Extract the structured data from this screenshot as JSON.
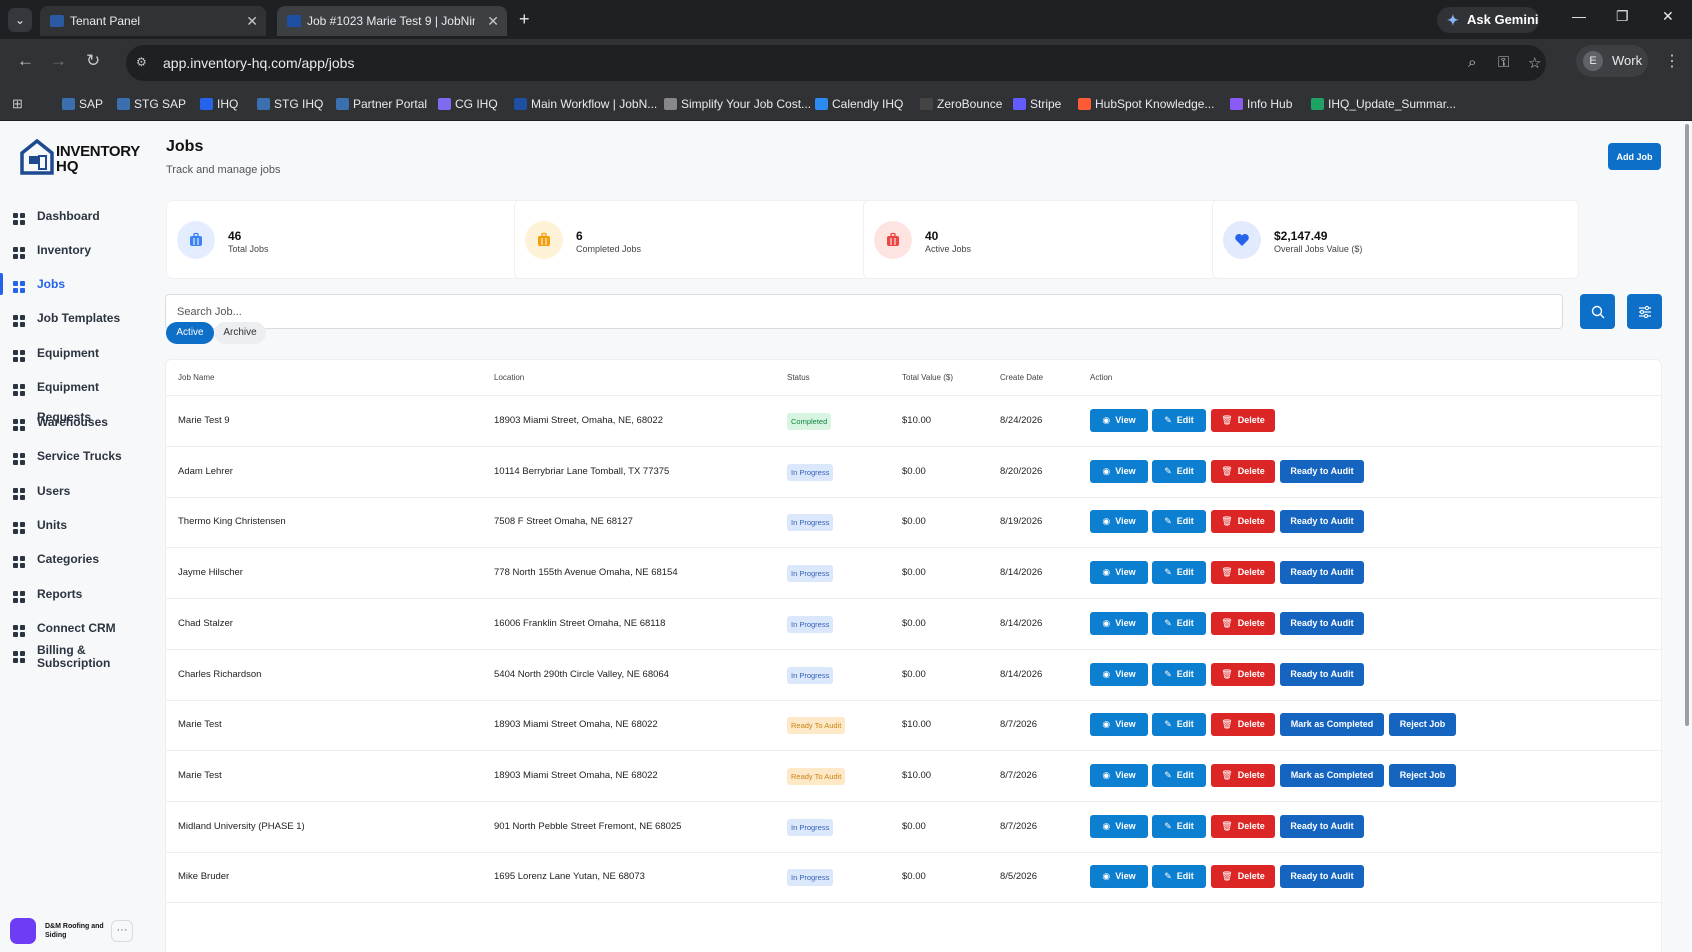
{
  "browser": {
    "tabs": [
      {
        "title": "Tenant Panel",
        "active": false
      },
      {
        "title": "Job #1023 Marie Test 9 | JobNimbus",
        "active": true
      }
    ],
    "ask_gemini": "Ask Gemini",
    "url": "app.inventory-hq.com/app/jobs",
    "profile": {
      "initial": "E",
      "name": "Work"
    },
    "bookmarks": [
      "SAP",
      "STG SAP",
      "IHQ",
      "STG IHQ",
      "Partner Portal",
      "CG IHQ",
      "Main Workflow | JobN...",
      "Simplify Your Job Cost...",
      "Calendly IHQ",
      "ZeroBounce",
      "Stripe",
      "HubSpot Knowledge...",
      "Info Hub",
      "IHQ_Update_Summar..."
    ]
  },
  "logo": {
    "line1": "INVENTORY",
    "line2": "HQ"
  },
  "sidebar": {
    "items": [
      {
        "label": "Dashboard",
        "icon": "dashboard-icon"
      },
      {
        "label": "Inventory",
        "icon": "inventory-icon"
      },
      {
        "label": "Jobs",
        "icon": "jobs-icon",
        "active": true
      },
      {
        "label": "Job Templates",
        "icon": "job-templates-icon"
      },
      {
        "label": "Equipment",
        "icon": "equipment-icon"
      },
      {
        "label": "Equipment Requests",
        "icon": "equipment-requests-icon"
      },
      {
        "label": "Warehouses",
        "icon": "warehouse-icon"
      },
      {
        "label": "Service Trucks",
        "icon": "truck-icon"
      },
      {
        "label": "Users",
        "icon": "users-icon"
      },
      {
        "label": "Units",
        "icon": "units-icon"
      },
      {
        "label": "Categories",
        "icon": "categories-icon"
      },
      {
        "label": "Reports",
        "icon": "reports-icon"
      },
      {
        "label": "Connect CRM",
        "icon": "crm-icon"
      },
      {
        "label": "Billing & Subscription",
        "icon": "billing-icon"
      }
    ],
    "org_name": "D&M Roofing and Siding"
  },
  "header": {
    "title": "Jobs",
    "subtitle": "Track and manage jobs",
    "add_button": "Add Job"
  },
  "stats": [
    {
      "value": "46",
      "label": "Total Jobs",
      "color": "#3b82f6"
    },
    {
      "value": "6",
      "label": "Completed Jobs",
      "color": "#f59e0b"
    },
    {
      "value": "40",
      "label": "Active Jobs",
      "color": "#ef4444"
    },
    {
      "value": "$2,147.49",
      "label": "Overall Jobs Value ($)",
      "color": "#2563eb"
    }
  ],
  "search": {
    "placeholder": "Search Job..."
  },
  "filter_tabs": {
    "active": "Active",
    "archive": "Archive"
  },
  "table": {
    "columns": [
      "Job Name",
      "Location",
      "Status",
      "Total Value ($)",
      "Create Date",
      "Action"
    ],
    "actions": {
      "view": "View",
      "edit": "Edit",
      "delete": "Delete"
    },
    "rows": [
      {
        "name": "Marie Test 9",
        "location": "18903 Miami Street, Omaha, NE, 68022",
        "status": "Completed",
        "value": "$10.00",
        "date": "8/24/2026",
        "extra": []
      },
      {
        "name": "Adam Lehrer",
        "location": "10114 Berrybriar Lane Tomball, TX 77375",
        "status": "In Progress",
        "value": "$0.00",
        "date": "8/20/2026",
        "extra": [
          "Ready to Audit"
        ]
      },
      {
        "name": "Thermo King Christensen",
        "location": "7508 F Street Omaha, NE 68127",
        "status": "In Progress",
        "value": "$0.00",
        "date": "8/19/2026",
        "extra": [
          "Ready to Audit"
        ]
      },
      {
        "name": "Jayme Hilscher",
        "location": "778 North 155th Avenue Omaha, NE 68154",
        "status": "In Progress",
        "value": "$0.00",
        "date": "8/14/2026",
        "extra": [
          "Ready to Audit"
        ]
      },
      {
        "name": "Chad Stalzer",
        "location": "16006 Franklin Street Omaha, NE 68118",
        "status": "In Progress",
        "value": "$0.00",
        "date": "8/14/2026",
        "extra": [
          "Ready to Audit"
        ]
      },
      {
        "name": "Charles Richardson",
        "location": "5404 North 290th Circle Valley, NE 68064",
        "status": "In Progress",
        "value": "$0.00",
        "date": "8/14/2026",
        "extra": [
          "Ready to Audit"
        ]
      },
      {
        "name": "Marie Test",
        "location": "18903 Miami Street Omaha, NE 68022",
        "status": "Ready To Audit",
        "value": "$10.00",
        "date": "8/7/2026",
        "extra": [
          "Mark as Completed",
          "Reject Job"
        ]
      },
      {
        "name": "Marie Test",
        "location": "18903 Miami Street Omaha, NE 68022",
        "status": "Ready To Audit",
        "value": "$10.00",
        "date": "8/7/2026",
        "extra": [
          "Mark as Completed",
          "Reject Job"
        ]
      },
      {
        "name": "Midland University (PHASE 1)",
        "location": "901 North Pebble Street Fremont, NE 68025",
        "status": "In Progress",
        "value": "$0.00",
        "date": "8/7/2026",
        "extra": [
          "Ready to Audit"
        ]
      },
      {
        "name": "Mike Bruder",
        "location": "1695 Lorenz Lane Yutan, NE 68073",
        "status": "In Progress",
        "value": "$0.00",
        "date": "8/5/2026",
        "extra": [
          "Ready to Audit"
        ]
      }
    ]
  }
}
